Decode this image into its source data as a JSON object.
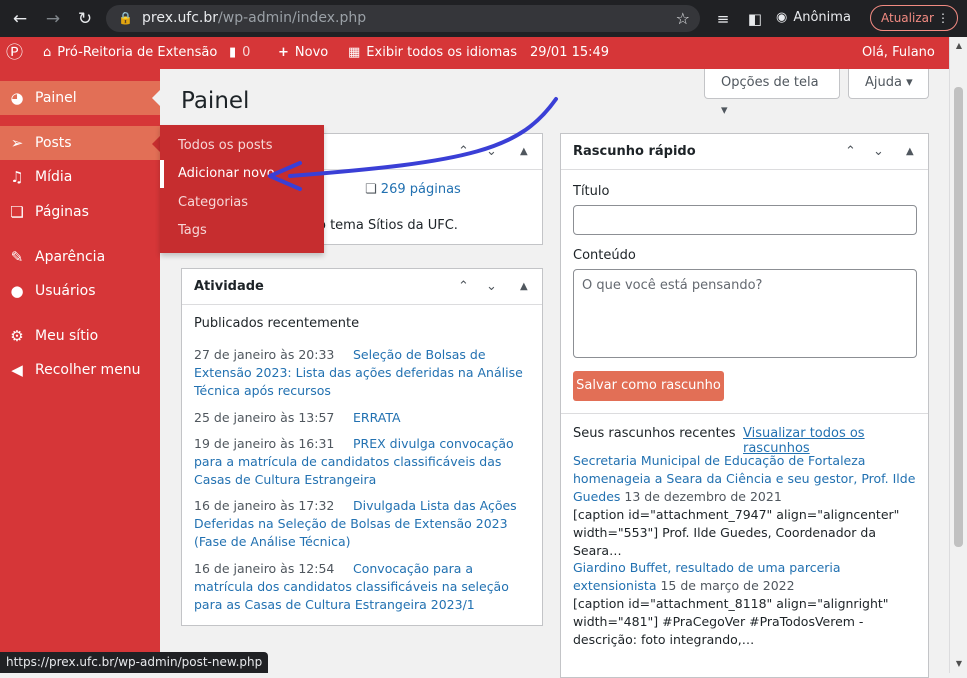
{
  "browser": {
    "url_host": "prex.ufc.br",
    "url_path": "/wp-admin/index.php",
    "profile_label": "Anônima",
    "update_label": "Atualizar",
    "status_url": "https://prex.ufc.br/wp-admin/post-new.php"
  },
  "adminbar": {
    "site_name": "Pró-Reitoria de Extensão",
    "comments_count": "0",
    "new_label": "Novo",
    "languages_label": "Exibir todos os idiomas",
    "datetime": "29/01 15:49",
    "greeting": "Olá, Fulano"
  },
  "sidebar": {
    "items": [
      {
        "label": "Painel",
        "icon": "dashboard-icon"
      },
      {
        "label": "Posts",
        "icon": "pin-icon"
      },
      {
        "label": "Mídia",
        "icon": "media-icon"
      },
      {
        "label": "Páginas",
        "icon": "pages-icon"
      },
      {
        "label": "Aparência",
        "icon": "brush-icon"
      },
      {
        "label": "Usuários",
        "icon": "user-icon"
      },
      {
        "label": "Meu sítio",
        "icon": "gear-icon"
      },
      {
        "label": "Recolher menu",
        "icon": "collapse-icon"
      }
    ],
    "posts_submenu": [
      "Todos os posts",
      "Adicionar novo",
      "Categorias",
      "Tags"
    ]
  },
  "main": {
    "title": "Painel",
    "screen_options": "Opções de tela ▾",
    "help": "Ajuda ▾"
  },
  "glance": {
    "pages": "269 páginas",
    "theme_text": "o tema Sítios da UFC."
  },
  "activity": {
    "title": "Atividade",
    "subtitle": "Publicados recentemente",
    "items": [
      {
        "date": "27 de janeiro às 20:33",
        "title": "Seleção de Bolsas de Extensão 2023: Lista das ações deferidas na Análise Técnica após recursos"
      },
      {
        "date": "25 de janeiro às 13:57",
        "title": "ERRATA"
      },
      {
        "date": "19 de janeiro às 16:31",
        "title": "PREX divulga convocação para a matrícula de candidatos classificáveis das Casas de Cultura Estrangeira"
      },
      {
        "date": "16 de janeiro às 17:32",
        "title": "Divulgada Lista das Ações Deferidas na Seleção de Bolsas de Extensão 2023 (Fase de Análise Técnica)"
      },
      {
        "date": "16 de janeiro às 12:54",
        "title": "Convocação para a matrícula dos candidatos classificáveis na seleção para as Casas de Cultura Estrangeira 2023/1"
      }
    ]
  },
  "quickdraft": {
    "title": "Rascunho rápido",
    "title_label": "Título",
    "content_label": "Conteúdo",
    "content_placeholder": "O que você está pensando?",
    "save_label": "Salvar como rascunho",
    "recent_label": "Seus rascunhos recentes",
    "view_all": "Visualizar todos os rascunhos",
    "drafts": [
      {
        "title": "Secretaria Municipal de Educação de Fortaleza homenageia a Seara da Ciência e seu gestor, Prof. Ilde Guedes",
        "date": "13 de dezembro de 2021",
        "excerpt": "[caption id=\"attachment_7947\" align=\"aligncenter\" width=\"553\"] Prof. Ilde Guedes, Coordenador da Seara…"
      },
      {
        "title": "Giardino Buffet, resultado de uma parceria extensionista",
        "date": "15 de março de 2022",
        "excerpt": "[caption id=\"attachment_8118\" align=\"alignright\" width=\"481\"] #PraCegoVer #PraTodosVerem - descrição: foto integrando,…"
      }
    ]
  },
  "colors": {
    "admin_red": "#d63638",
    "highlight": "#e26f56",
    "annotation_arrow": "#3a3fd6"
  }
}
